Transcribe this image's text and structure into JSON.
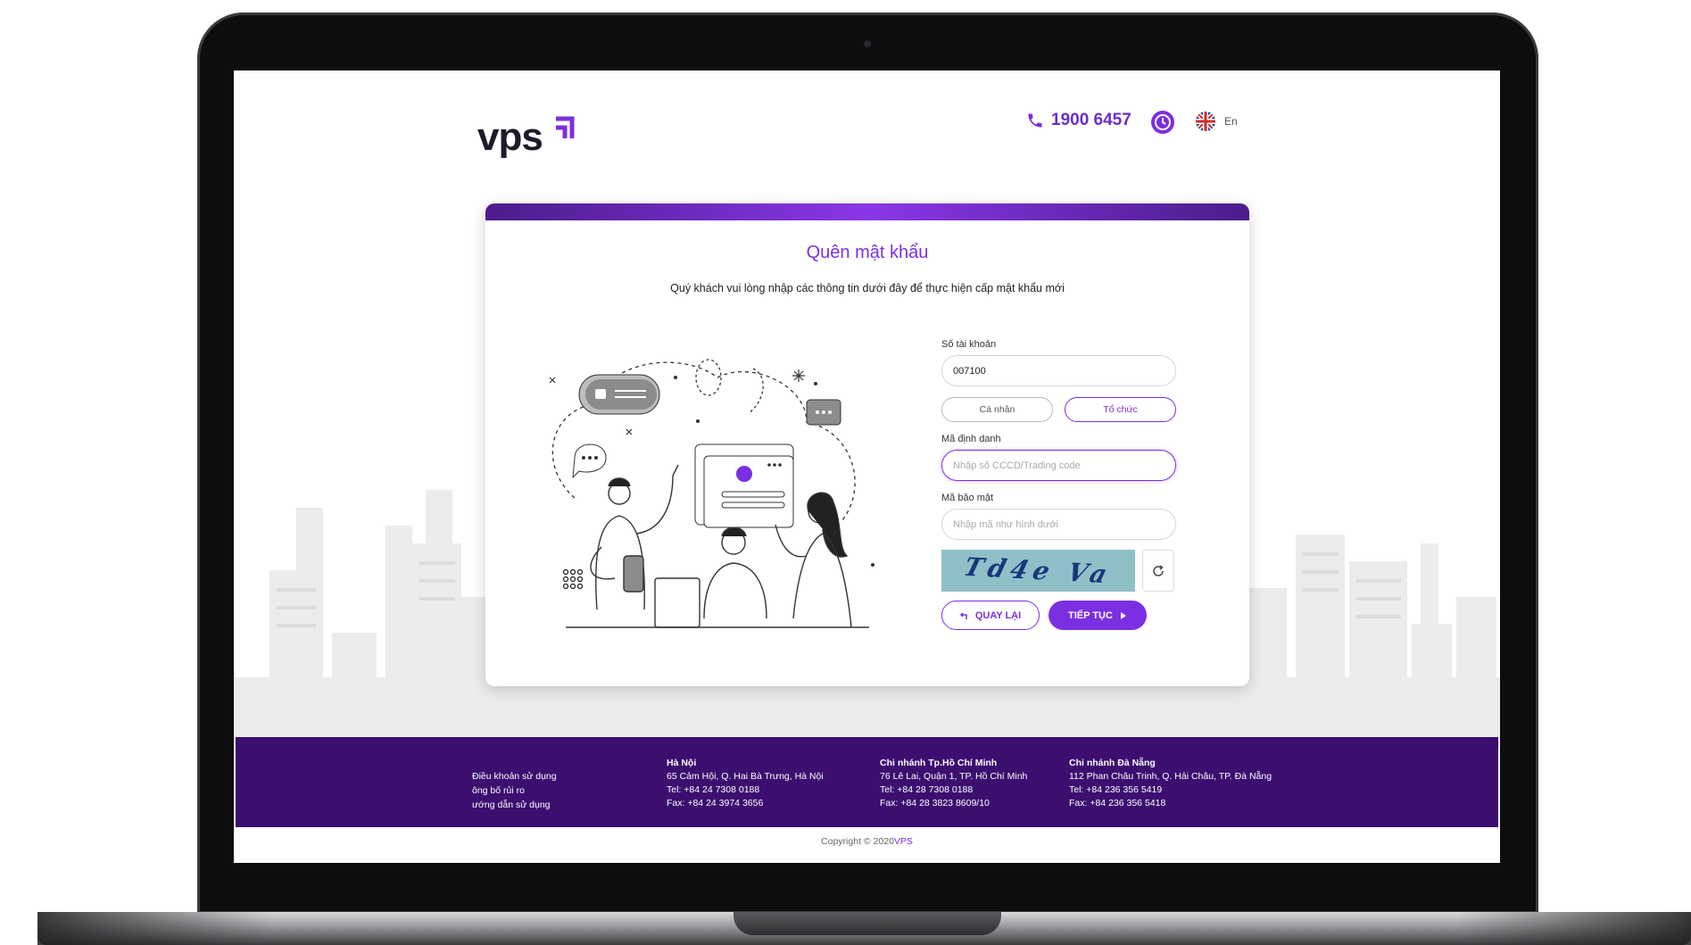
{
  "header": {
    "logo_text": "vps",
    "hotline": "1900 6457",
    "language": "En"
  },
  "card": {
    "title": "Quên mật khẩu",
    "subtitle": "Quý khách vui lòng nhập các thông tin dưới đây để thực hiện cấp mật khẩu mới"
  },
  "form": {
    "account_label": "Số tài khoản",
    "account_value": "007100",
    "type_individual": "Cá nhân",
    "type_organization": "Tổ chức",
    "id_label": "Mã định danh",
    "id_placeholder": "Nhập số CCCD/Trading code",
    "security_label": "Mã bảo mật",
    "security_placeholder": "Nhập mã như hình dưới",
    "captcha_text": "Td4e Va",
    "back_label": "QUAY LẠI",
    "next_label": "TIẾP TỤC"
  },
  "footer": {
    "links": [
      "Điều khoản sử dụng",
      "ông bố rủi ro",
      "ướng dẫn sử dụng"
    ],
    "offices": [
      {
        "title": "Hà Nội",
        "address": "65 Cảm Hội, Q. Hai Bà Trưng, Hà Nội",
        "tel": "Tel: +84 24 7308 0188",
        "fax": "Fax: +84 24 3974 3656"
      },
      {
        "title": "Chi nhánh Tp.Hồ Chí Minh",
        "address": "76 Lê Lai, Quận 1, TP. Hồ Chí Minh",
        "tel": "Tel: +84 28 7308 0188",
        "fax": "Fax: +84 28 3823 8609/10"
      },
      {
        "title": "Chi nhánh Đà Nẵng",
        "address": "112 Phan Châu Trinh, Q. Hải Châu, TP. Đà Nẵng",
        "tel": "Tel: +84 236 356 5419",
        "fax": "Fax: +84 236 356 5418"
      }
    ],
    "copyright_prefix": "Copyright © 2020",
    "copyright_brand": "VPS"
  },
  "colors": {
    "brand": "#7b2fe0",
    "footer_bg": "#3b0e70",
    "captcha_bg": "#8fc0c8"
  },
  "icons": {
    "phone": "phone-icon",
    "clock": "clock-icon",
    "flag": "uk-flag-icon",
    "refresh": "refresh-icon",
    "back": "return-arrow-icon",
    "next": "play-arrow-icon"
  }
}
